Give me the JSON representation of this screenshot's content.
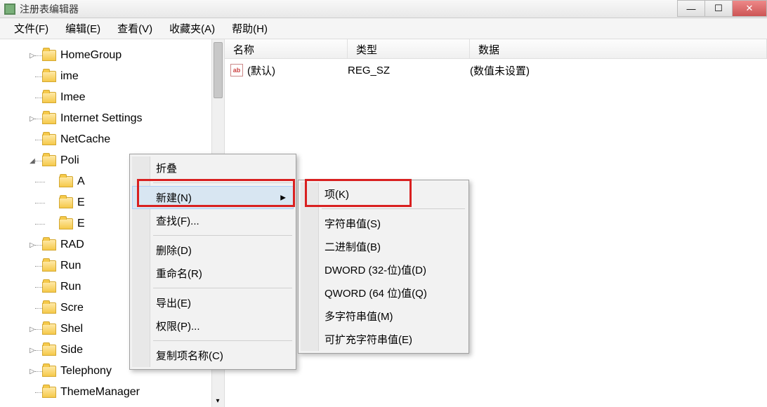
{
  "window": {
    "title": "注册表编辑器"
  },
  "menubar": [
    "文件(F)",
    "编辑(E)",
    "查看(V)",
    "收藏夹(A)",
    "帮助(H)"
  ],
  "tree": {
    "items": [
      {
        "label": "HomeGroup",
        "expander": "▷",
        "indent": 0
      },
      {
        "label": "ime",
        "expander": "",
        "indent": 0
      },
      {
        "label": "Imee",
        "expander": "",
        "indent": 0
      },
      {
        "label": "Internet Settings",
        "expander": "▷",
        "indent": 0
      },
      {
        "label": "NetCache",
        "expander": "",
        "indent": 0
      },
      {
        "label": "Poli",
        "expander": "◢",
        "indent": 0,
        "selected": false
      },
      {
        "label": "A",
        "expander": "",
        "indent": 1
      },
      {
        "label": "E",
        "expander": "",
        "indent": 1
      },
      {
        "label": "E",
        "expander": "",
        "indent": 1
      },
      {
        "label": "RAD",
        "expander": "▷",
        "indent": 0
      },
      {
        "label": "Run",
        "expander": "",
        "indent": 0
      },
      {
        "label": "Run",
        "expander": "",
        "indent": 0
      },
      {
        "label": "Scre",
        "expander": "",
        "indent": 0
      },
      {
        "label": "Shel",
        "expander": "▷",
        "indent": 0
      },
      {
        "label": "Side",
        "expander": "▷",
        "indent": 0
      },
      {
        "label": "Telephony",
        "expander": "▷",
        "indent": 0
      },
      {
        "label": "ThemeManager",
        "expander": "",
        "indent": 0
      }
    ]
  },
  "list": {
    "columns": [
      "名称",
      "类型",
      "数据"
    ],
    "rows": [
      {
        "icon": "ab",
        "name": "(默认)",
        "type": "REG_SZ",
        "data": "(数值未设置)"
      }
    ]
  },
  "contextMenu1": {
    "items": [
      {
        "label": "折叠",
        "type": "item"
      },
      {
        "type": "sep"
      },
      {
        "label": "新建(N)",
        "type": "submenu",
        "hover": true
      },
      {
        "label": "查找(F)...",
        "type": "item"
      },
      {
        "type": "sep"
      },
      {
        "label": "删除(D)",
        "type": "item"
      },
      {
        "label": "重命名(R)",
        "type": "item"
      },
      {
        "type": "sep"
      },
      {
        "label": "导出(E)",
        "type": "item"
      },
      {
        "label": "权限(P)...",
        "type": "item"
      },
      {
        "type": "sep"
      },
      {
        "label": "复制项名称(C)",
        "type": "item"
      }
    ]
  },
  "contextMenu2": {
    "items": [
      {
        "label": "项(K)",
        "type": "item"
      },
      {
        "type": "sep"
      },
      {
        "label": "字符串值(S)",
        "type": "item"
      },
      {
        "label": "二进制值(B)",
        "type": "item"
      },
      {
        "label": "DWORD (32-位)值(D)",
        "type": "item"
      },
      {
        "label": "QWORD (64 位)值(Q)",
        "type": "item"
      },
      {
        "label": "多字符串值(M)",
        "type": "item"
      },
      {
        "label": "可扩充字符串值(E)",
        "type": "item"
      }
    ]
  }
}
